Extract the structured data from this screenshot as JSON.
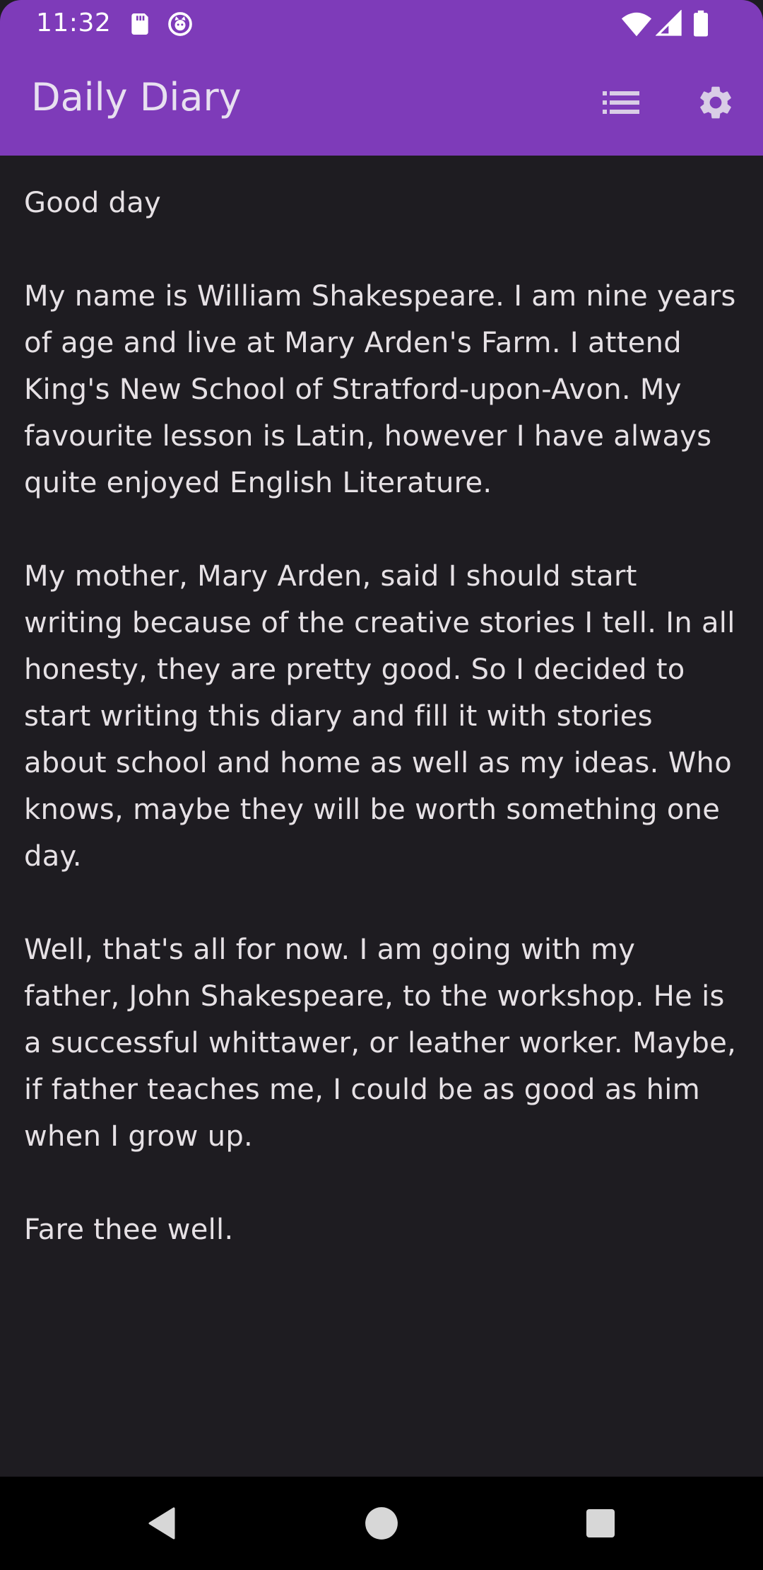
{
  "status_bar": {
    "time": "11:32",
    "icons": [
      "sd-card-icon",
      "notification-app-icon",
      "wifi-icon",
      "signal-icon",
      "battery-icon"
    ]
  },
  "app_bar": {
    "title": "Daily Diary",
    "actions": [
      "list-icon",
      "gear-icon"
    ]
  },
  "entry": {
    "text": "Good day\n\nMy name is William Shakespeare. I am nine years of age and live at Mary Arden's Farm. I attend King's New School of Stratford-upon-Avon. My favourite lesson is Latin, however I have always quite enjoyed English Literature.\n\nMy mother, Mary Arden, said I should start writing because of the creative stories I tell. In all honesty, they are pretty good. So I decided to start writing this diary and fill it with stories about school and home as well as my ideas. Who knows, maybe they will be worth something one day.\n\nWell, that's all for now. I am going with my father, John Shakespeare, to the workshop. He is a successful whittawer, or leather worker. Maybe, if father teaches me, I could be as good as him when I grow up.\n\nFare thee well."
  },
  "nav_bar": {
    "buttons": [
      "back-icon",
      "home-icon",
      "recents-icon"
    ]
  },
  "colors": {
    "primary": "#7e3bb9",
    "background": "#1e1c21",
    "text": "#e6e1e5"
  }
}
